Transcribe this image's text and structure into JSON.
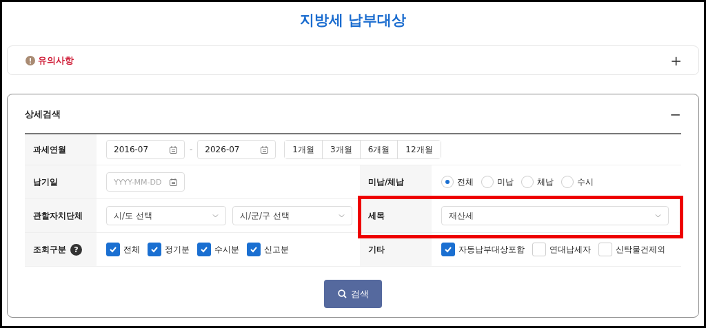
{
  "title": "지방세 납부대상",
  "notice": {
    "label": "유의사항",
    "toggle": "+"
  },
  "search": {
    "title": "상세검색",
    "toggle": "−",
    "rows": [
      {
        "fields": [
          {
            "label": "과세연월",
            "kind": "date_range",
            "from": "2016-07",
            "separator": "-",
            "to": "2026-07",
            "periods": [
              "1개월",
              "3개월",
              "6개월",
              "12개월"
            ]
          }
        ]
      },
      {
        "fields": [
          {
            "label": "납기일",
            "kind": "date",
            "placeholder": "YYYY-MM-DD"
          },
          {
            "label": "미납/체납",
            "kind": "radio",
            "options": [
              {
                "label": "전체",
                "selected": true
              },
              {
                "label": "미납",
                "selected": false
              },
              {
                "label": "체납",
                "selected": false
              },
              {
                "label": "수시",
                "selected": false
              }
            ]
          }
        ]
      },
      {
        "fields": [
          {
            "label": "관할자치단체",
            "kind": "selects",
            "selects": [
              "시/도 선택",
              "시/군/구 선택"
            ]
          },
          {
            "label": "세목",
            "kind": "selects",
            "selects": [
              "재산세"
            ],
            "highlighted": true
          }
        ]
      },
      {
        "fields": [
          {
            "label": "조회구분",
            "help": "?",
            "kind": "checks",
            "options": [
              {
                "label": "전체",
                "checked": true
              },
              {
                "label": "정기분",
                "checked": true
              },
              {
                "label": "수시분",
                "checked": true
              },
              {
                "label": "신고분",
                "checked": true
              }
            ]
          },
          {
            "label": "기타",
            "kind": "checks",
            "options": [
              {
                "label": "자동납부대상포함",
                "checked": true
              },
              {
                "label": "연대납세자",
                "checked": false
              },
              {
                "label": "신탁물건제외",
                "checked": false
              }
            ]
          }
        ]
      }
    ],
    "button": "검색"
  }
}
